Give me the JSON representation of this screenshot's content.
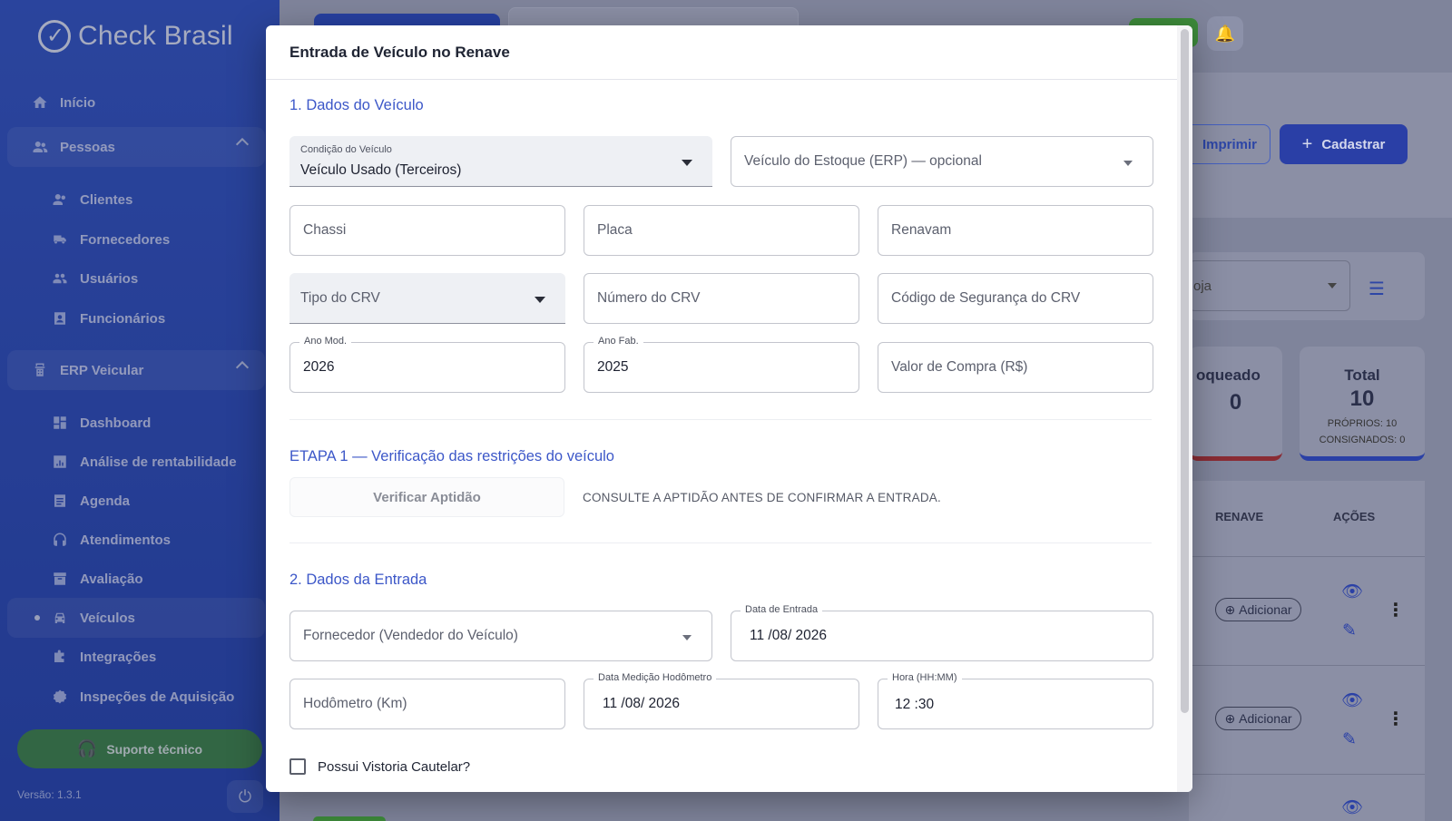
{
  "brand": {
    "name": "Check Brasil"
  },
  "sidebar": {
    "items": [
      {
        "label": "Início",
        "icon": "home-icon"
      },
      {
        "label": "Pessoas",
        "icon": "people-icon"
      },
      {
        "label": "Clientes",
        "icon": "clients-icon"
      },
      {
        "label": "Fornecedores",
        "icon": "truck-icon"
      },
      {
        "label": "Usuários",
        "icon": "users-icon"
      },
      {
        "label": "Funcionários",
        "icon": "badge-icon"
      },
      {
        "label": "ERP Veicular",
        "icon": "building-icon"
      },
      {
        "label": "Dashboard",
        "icon": "dashboard-icon"
      },
      {
        "label": "Análise de rentabilidade",
        "icon": "chart-icon"
      },
      {
        "label": "Agenda",
        "icon": "calendar-icon"
      },
      {
        "label": "Atendimentos",
        "icon": "headset-icon"
      },
      {
        "label": "Avaliação",
        "icon": "archive-icon"
      },
      {
        "label": "Veículos",
        "icon": "car-icon"
      },
      {
        "label": "Integrações",
        "icon": "puzzle-icon"
      },
      {
        "label": "Inspeções de Aquisição",
        "icon": "inspection-icon"
      }
    ],
    "support_label": "Suporte técnico",
    "version": "Versão: 1.3.1"
  },
  "background": {
    "buttons": {
      "print": "Imprimir",
      "create": "Cadastrar"
    },
    "filter_placeholder": "oja",
    "stats": [
      {
        "title": "oqueado",
        "value": "0"
      },
      {
        "title": "Total",
        "value": "10",
        "detail_1": "PRÓPRIOS: 10",
        "detail_2": "CONSIGNADOS: 0"
      }
    ],
    "table": {
      "headers": [
        "RENAVE",
        "AÇÕES"
      ],
      "rows": [
        {
          "renave_action": "Adicionar"
        },
        {
          "renave_action": "Adicionar"
        }
      ]
    }
  },
  "modal": {
    "title": "Entrada de Veículo no Renave",
    "section1_title": "1. Dados do Veículo",
    "fields": {
      "condicao": {
        "label": "Condição do Veículo",
        "value": "Veículo Usado (Terceiros)"
      },
      "estoque": {
        "placeholder": "Veículo do Estoque (ERP) — opcional"
      },
      "chassi": {
        "placeholder": "Chassi"
      },
      "placa": {
        "placeholder": "Placa"
      },
      "renavam": {
        "placeholder": "Renavam"
      },
      "tipo_crv": {
        "placeholder": "Tipo do CRV"
      },
      "numero_crv": {
        "placeholder": "Número do CRV"
      },
      "codigo_crv": {
        "placeholder": "Código de Segurança do CRV"
      },
      "ano_mod": {
        "label": "Ano Mod.",
        "value": "2026"
      },
      "ano_fab": {
        "label": "Ano Fab.",
        "value": "2025"
      },
      "valor_compra": {
        "placeholder": "Valor de Compra (R$)"
      },
      "fornecedor": {
        "placeholder": "Fornecedor (Vendedor do Veículo)"
      },
      "data_entrada": {
        "label": "Data de Entrada",
        "value": "11 /08/ 2026"
      },
      "hodometro": {
        "placeholder": "Hodômetro (Km)"
      },
      "data_hodometro": {
        "label": "Data Medição Hodômetro",
        "value": "11 /08/ 2026"
      },
      "hora": {
        "label": "Hora (HH:MM)",
        "value": "12 :30"
      }
    },
    "step1_title": "ETAPA 1 — Verificação das restrições do veículo",
    "verify_button": "Verificar Aptidão",
    "verify_hint": "CONSULTE A APTIDÃO ANTES DE CONFIRMAR A ENTRADA.",
    "section2_title": "2. Dados da Entrada",
    "cautelar_label": "Possui Vistoria Cautelar?"
  },
  "colors": {
    "primary": "#2c51c6",
    "accent_text": "#3c57c8",
    "success": "#3d9a3a"
  }
}
